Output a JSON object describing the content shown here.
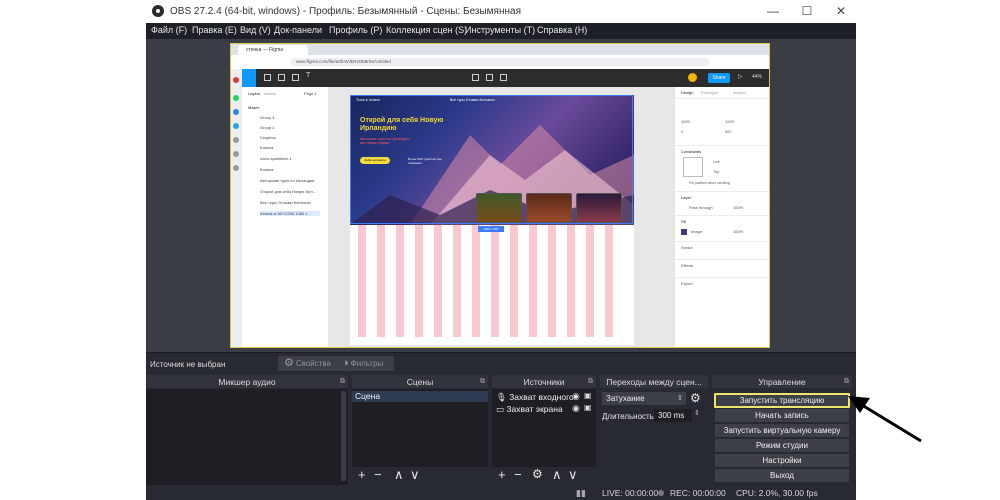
{
  "window": {
    "title": "OBS 27.2.4 (64-bit, windows) - Профиль: Безымянный - Сцены: Безымянная",
    "controls": {
      "minimize": "—",
      "maximize": "☐",
      "close": "✕"
    }
  },
  "menu": [
    "Файл (F)",
    "Правка (E)",
    "Вид (V)",
    "Док-панели",
    "Профиль (P)",
    "Коллекция сцен (S)",
    "Инструменты (T)",
    "Справка (H)"
  ],
  "preview": {
    "browser": {
      "tab": "стенка — Figma",
      "url": "www.figma.com/file/a0fcW3kR2rBt8rDs/Untitled"
    },
    "figma": {
      "share_label": "Share",
      "zoom": "44%",
      "left_tabs": {
        "layers": "Layers",
        "assets": "Assets",
        "page": "Page 1"
      },
      "layers": [
        "Макет",
        "Group 4",
        "Group 2",
        "Секреты",
        "Бланка",
        "icons.sparklines 1",
        "Бланка",
        "Авторские туры по Ирландии",
        "Открой для себя Новую Ирл...",
        "Все туры Отзывы Контакты",
        "Ireland-w 607/2345 1080 1"
      ],
      "right_tabs": {
        "design": "Design",
        "prototype": "Prototype",
        "inspect": "Inspect"
      },
      "right_sections": {
        "constraints": "Constraints",
        "layer": "Layer",
        "fill": "Fill",
        "stroke": "Stroke",
        "effects": "Effects",
        "export": "Export"
      },
      "right_values": {
        "x": "1920",
        "w": "1920",
        "y": "0",
        "h": "987",
        "left": "Left",
        "top": "Top",
        "pass_through": "Pass through",
        "opacity": "100%",
        "fill_label": "Image",
        "fill_opacity": "100%",
        "fix_scroll": "Fix position when scrolling"
      },
      "site": {
        "logo": "Tours & Ireland",
        "nav": "Все туры   Отзывы   Контакты",
        "title": "Открой для себя Новую Ирландию",
        "subtitle": "Авторские туры по Ирландии с местными гидами",
        "button": "Забронировать",
        "side_text": "Более 500 туристов уже побывали",
        "size_label": "1920 × 987"
      }
    }
  },
  "source_bar": {
    "label": "Источник не выбран",
    "properties": "Свойства",
    "filters": "Фильтры"
  },
  "docks": {
    "mixer": {
      "title": "Микшер аудио"
    },
    "scenes": {
      "title": "Сцены",
      "items": [
        "Сцена"
      ]
    },
    "sources": {
      "title": "Источники",
      "items": [
        "Захват входного",
        "Захват экрана"
      ]
    },
    "transitions": {
      "title": "Переходы между сцен...",
      "type": "Затухание",
      "duration_label": "Длительность",
      "duration": "300 ms"
    },
    "controls": {
      "title": "Управление",
      "buttons": [
        "Запустить трансляцию",
        "Начать запись",
        "Запустить виртуальную камеру",
        "Режим студии",
        "Настройки",
        "Выход"
      ]
    }
  },
  "status": {
    "live": "LIVE: 00:00:00",
    "rec": "REC: 00:00:00",
    "cpu": "CPU: 2.0%, 30.00 fps"
  },
  "colors": {
    "highlight": "#f1e36b",
    "arrow": "#000000",
    "obs_bg": "#272a33",
    "panel_head": "#31343d"
  }
}
